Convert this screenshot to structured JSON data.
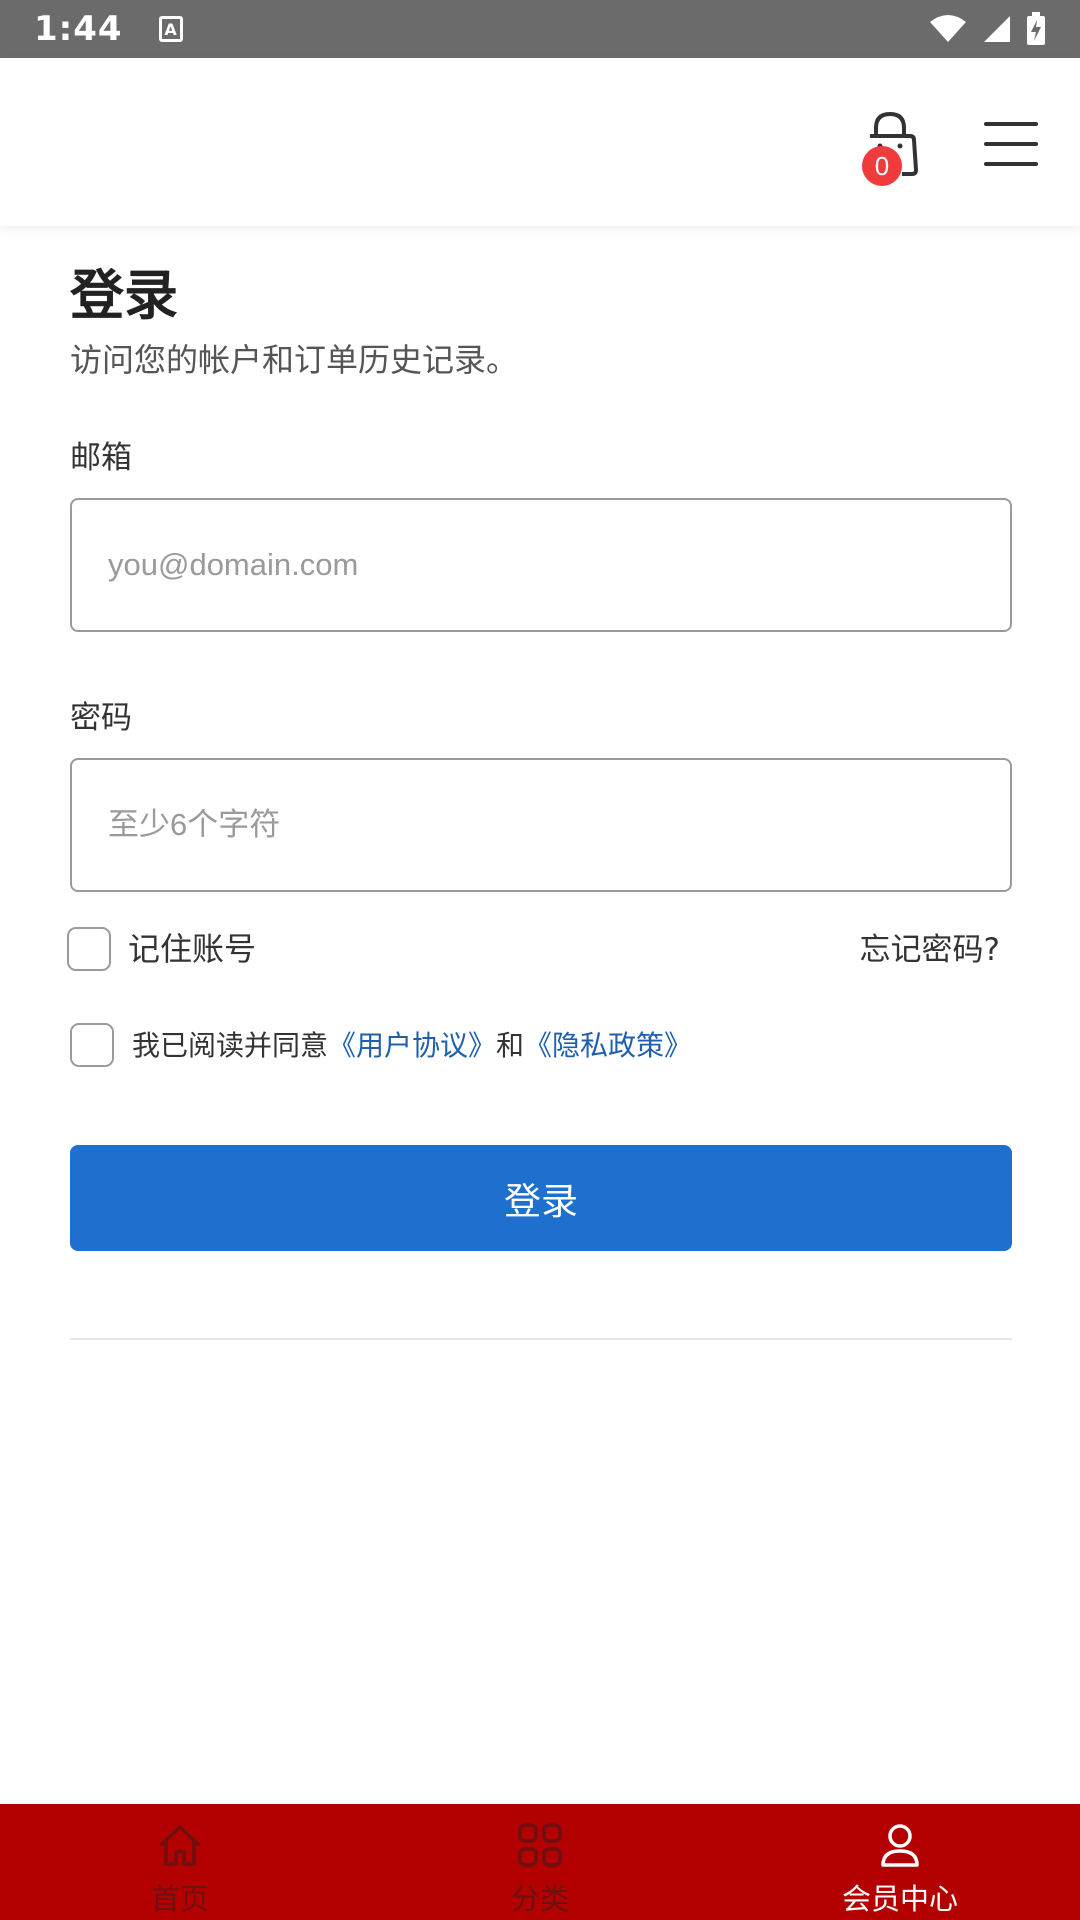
{
  "status_bar": {
    "time": "1:44",
    "app_icon_letter": "A",
    "icons": [
      "wifi-icon",
      "signal-icon",
      "battery-charging-icon"
    ]
  },
  "header": {
    "cart_count": "0",
    "icons": [
      "shopping-bag-icon",
      "hamburger-menu-icon"
    ]
  },
  "login": {
    "title": "登录",
    "subtitle": "访问您的帐户和订单历史记录。",
    "email_label": "邮箱",
    "email_placeholder": "you@domain.com",
    "email_value": "",
    "password_label": "密码",
    "password_placeholder": "至少6个字符",
    "password_value": "",
    "remember_label": "记住账号",
    "remember_checked": false,
    "forgot_label": "忘记密码?",
    "agree_prefix": "我已阅读并同意",
    "agree_link_terms": "《用户协议》",
    "agree_middle": "和",
    "agree_link_privacy": "《隐私政策》",
    "agree_checked": false,
    "submit_label": "登录"
  },
  "bottom_nav": {
    "items": [
      {
        "label": "首页",
        "icon": "home-icon",
        "active": false
      },
      {
        "label": "分类",
        "icon": "grid-icon",
        "active": false
      },
      {
        "label": "会员中心",
        "icon": "user-icon",
        "active": true
      }
    ]
  },
  "colors": {
    "primary_button": "#1f6fcf",
    "bottom_nav_bg": "#b30000",
    "badge": "#ef3b3b",
    "link": "#1f5fae",
    "status_bar": "#6b6b6b"
  }
}
